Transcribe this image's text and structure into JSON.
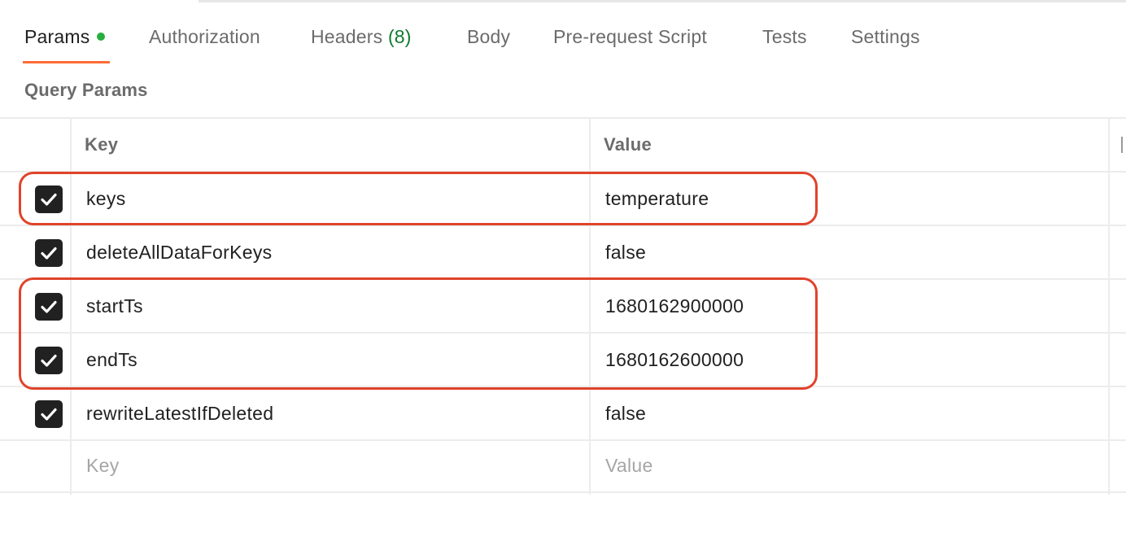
{
  "tabs": {
    "params": "Params",
    "authorization": "Authorization",
    "headers": "Headers",
    "headers_count": "(8)",
    "body": "Body",
    "pre_request": "Pre-request Script",
    "tests": "Tests",
    "settings": "Settings"
  },
  "section_title": "Query Params",
  "table": {
    "header_key": "Key",
    "header_value": "Value",
    "rows": [
      {
        "key": "keys",
        "value": "temperature",
        "checked": true
      },
      {
        "key": "deleteAllDataForKeys",
        "value": "false",
        "checked": true
      },
      {
        "key": "startTs",
        "value": "1680162900000",
        "checked": true
      },
      {
        "key": "endTs",
        "value": "1680162600000",
        "checked": true
      },
      {
        "key": "rewriteLatestIfDeleted",
        "value": "false",
        "checked": true
      }
    ],
    "placeholder_key": "Key",
    "placeholder_value": "Value"
  },
  "colors": {
    "active_tab_underline": "#ff6c37",
    "params_dot": "#27ae3c",
    "headers_count": "#0c7a2c",
    "highlight": "#e0432b",
    "checkbox": "#212121"
  },
  "icons": {
    "checkbox": "check-icon"
  }
}
